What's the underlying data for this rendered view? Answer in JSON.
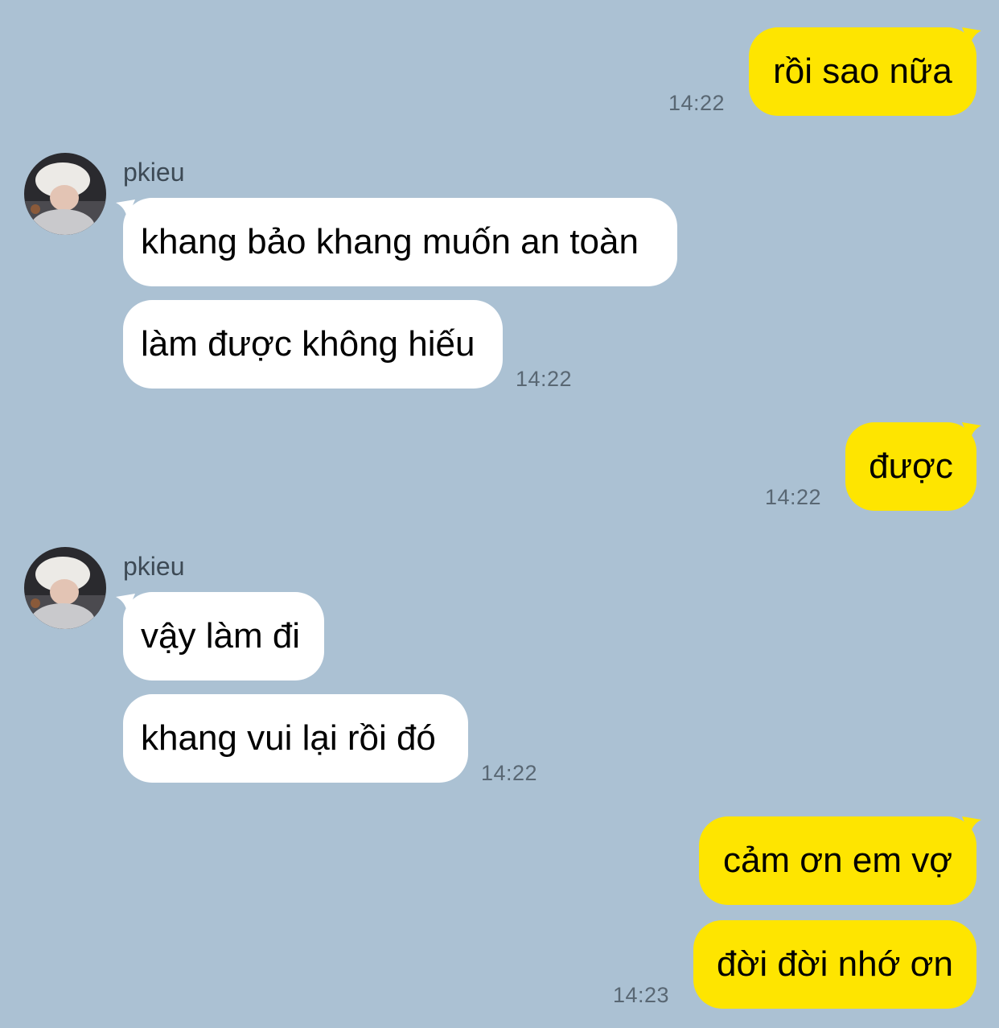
{
  "theme": {
    "background": "#abc1d3",
    "incoming_bubble": "#ffffff",
    "outgoing_bubble": "#fee500",
    "time_color": "#596773"
  },
  "messages": [
    {
      "text": "rồi sao nữa",
      "direction": "outgoing",
      "time": "14:22"
    },
    {
      "sender": "pkieu",
      "avatar_icon": "user-avatar-icon",
      "texts": [
        "khang bảo khang muốn an toàn",
        "làm được không hiếu"
      ],
      "direction": "incoming",
      "time": "14:22"
    },
    {
      "text": "được",
      "direction": "outgoing",
      "time": "14:22"
    },
    {
      "sender": "pkieu",
      "avatar_icon": "user-avatar-icon",
      "texts": [
        "vậy làm đi",
        "khang vui lại rồi đó"
      ],
      "direction": "incoming",
      "time": "14:22"
    },
    {
      "texts": [
        "cảm ơn em vợ",
        "đời đời nhớ ơn"
      ],
      "direction": "outgoing",
      "time": "14:23"
    }
  ]
}
